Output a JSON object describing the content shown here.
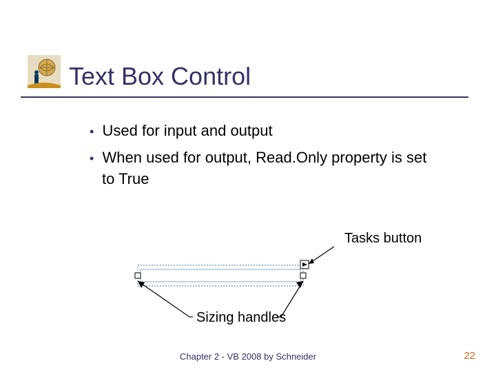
{
  "title": "Text Box Control",
  "bullets": [
    "Used for input and output",
    "When used for output, Read.Only property is set to True"
  ],
  "labels": {
    "tasks": "Tasks button",
    "handles": "Sizing handles"
  },
  "footer": "Chapter 2 - VB 2008 by Schneider",
  "page": "22"
}
